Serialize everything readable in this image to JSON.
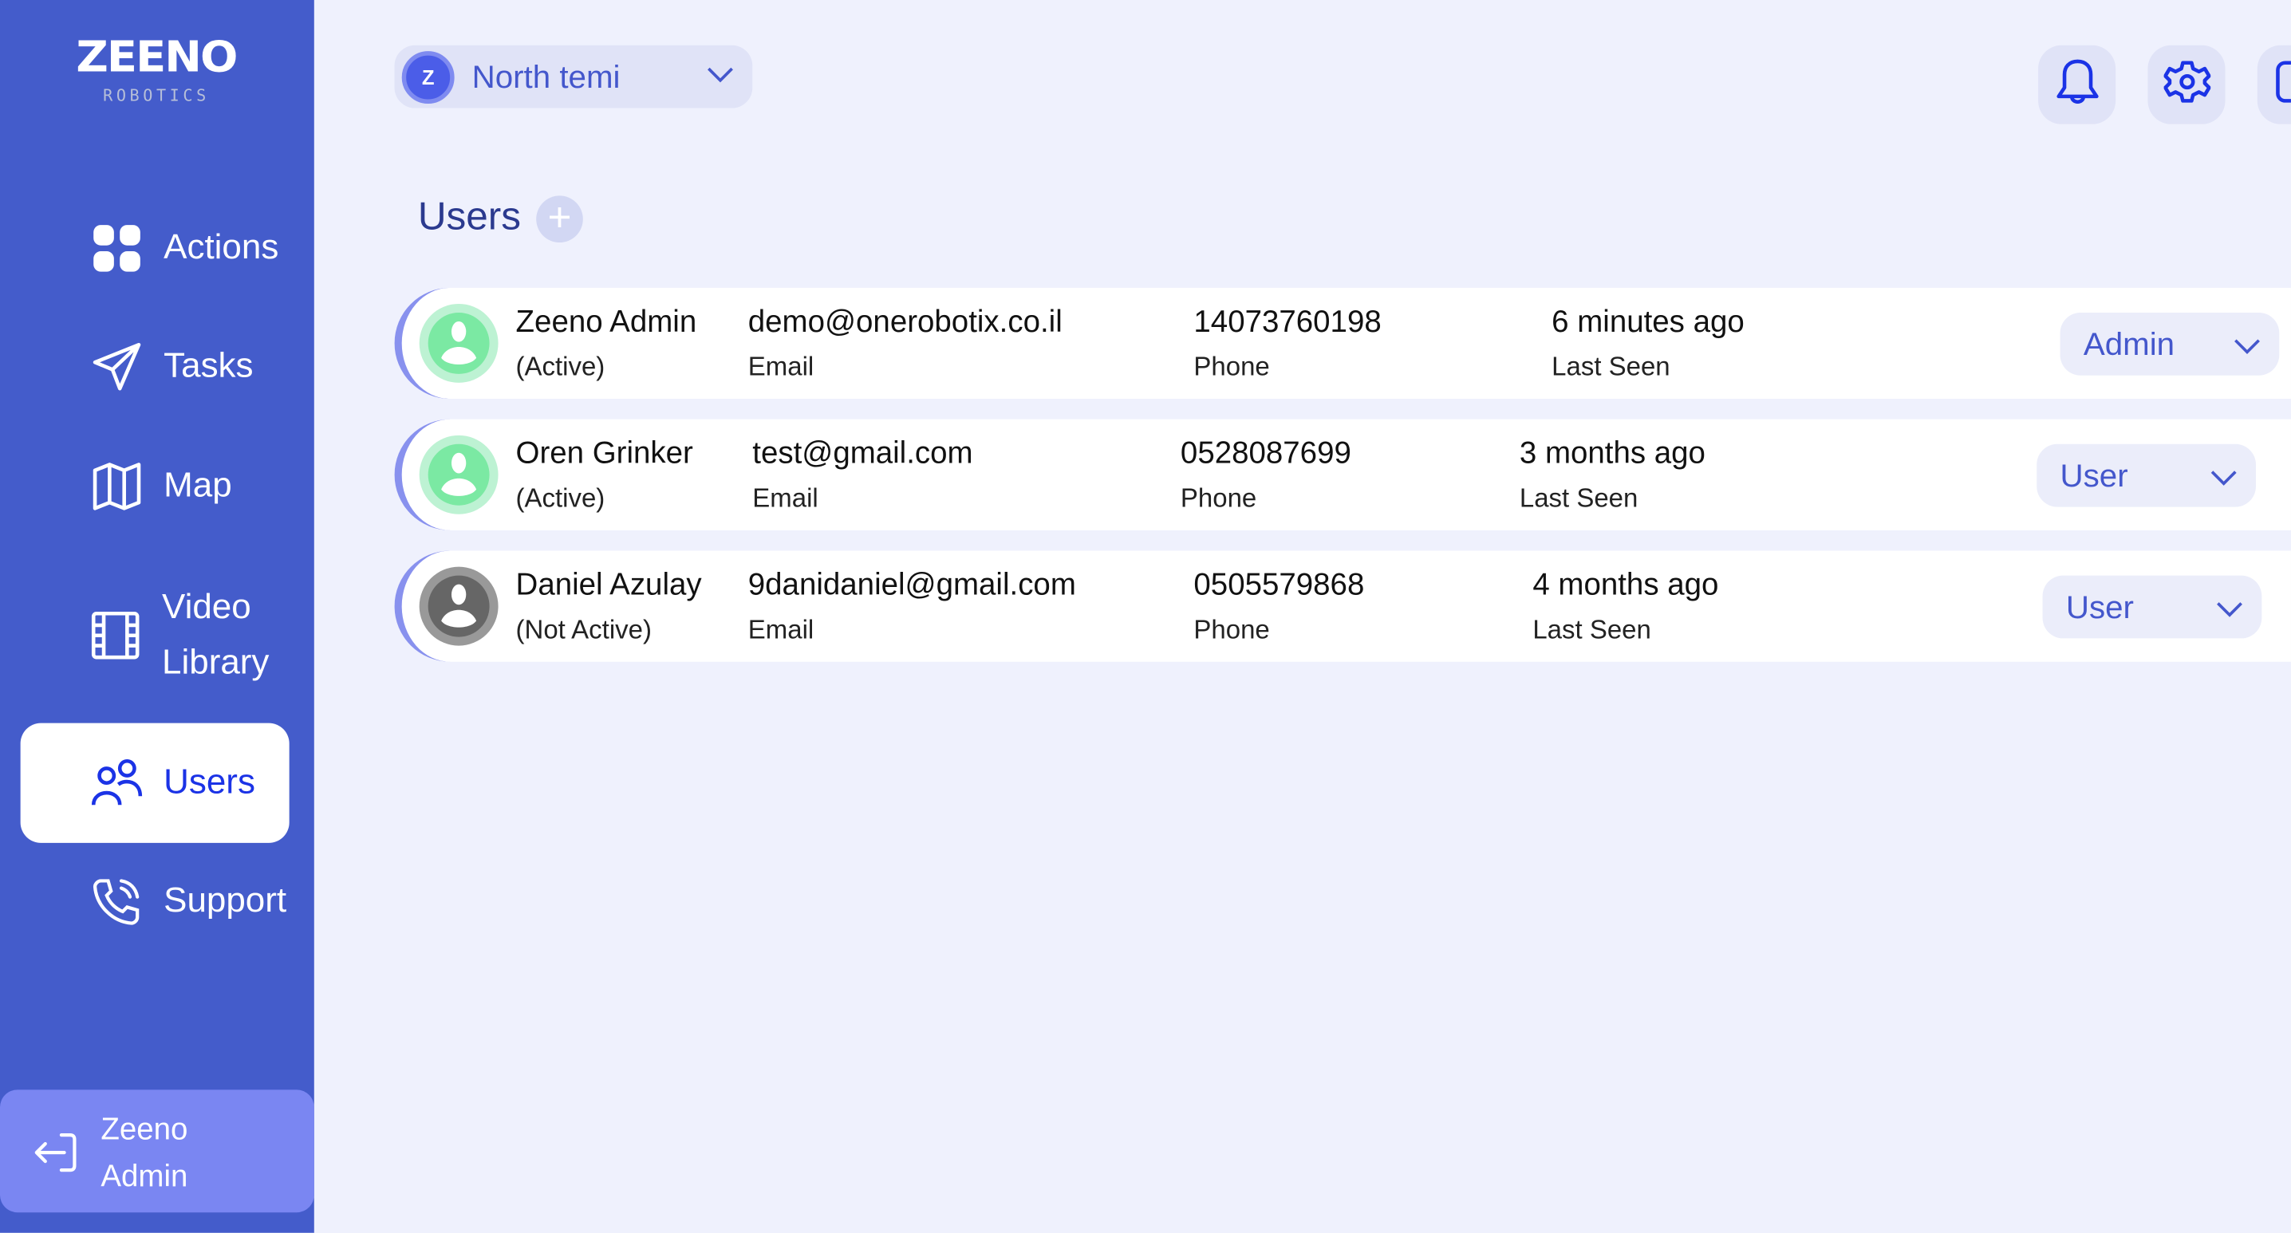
{
  "sidebar": {
    "logo": {
      "title": "ZEENO",
      "subtitle": "ROBOTICS"
    },
    "items": [
      {
        "label": "Actions",
        "icon": "grid-icon"
      },
      {
        "label": "Tasks",
        "icon": "paper-plane-icon"
      },
      {
        "label": "Map",
        "icon": "map-icon"
      },
      {
        "label": "Video Library",
        "icon": "film-icon"
      },
      {
        "label": "Users",
        "icon": "users-icon",
        "active": true
      },
      {
        "label": "Support",
        "icon": "phone-icon"
      }
    ],
    "current_user": {
      "line1": "Zeeno",
      "line2": "Admin",
      "icon": "logout-icon"
    }
  },
  "header": {
    "robot_select": {
      "avatar_letter": "Z",
      "value": "North temi"
    },
    "buttons": [
      "bell-icon",
      "gear-icon",
      "more-icon"
    ]
  },
  "main": {
    "title": "Users",
    "users": [
      {
        "name": "Zeeno Admin",
        "status": "(Active)",
        "email": "demo@onerobotix.co.il",
        "email_label": "Email",
        "phone": "14073760198",
        "phone_label": "Phone",
        "last_seen": "6 minutes ago",
        "last_seen_label": "Last Seen",
        "role": "Admin"
      },
      {
        "name": "Oren Grinker",
        "status": "(Active)",
        "email": "test@gmail.com",
        "email_label": "Email",
        "phone": "0528087699",
        "phone_label": "Phone",
        "last_seen": "3 months ago",
        "last_seen_label": "Last Seen",
        "role": "User"
      },
      {
        "name": "Daniel Azulay",
        "status": "(Not Active)",
        "email": "9danidaniel@gmail.com",
        "email_label": "Email",
        "phone": "0505579868",
        "phone_label": "Phone",
        "last_seen": "4 months ago",
        "last_seen_label": "Last Seen",
        "role": "User"
      }
    ]
  },
  "colors": {
    "sidebar": "#445CCB",
    "accent": "#1B33E6",
    "background": "#EFF1FD",
    "active_avatar": "#7BE9A3",
    "inactive_avatar": "#666666"
  }
}
